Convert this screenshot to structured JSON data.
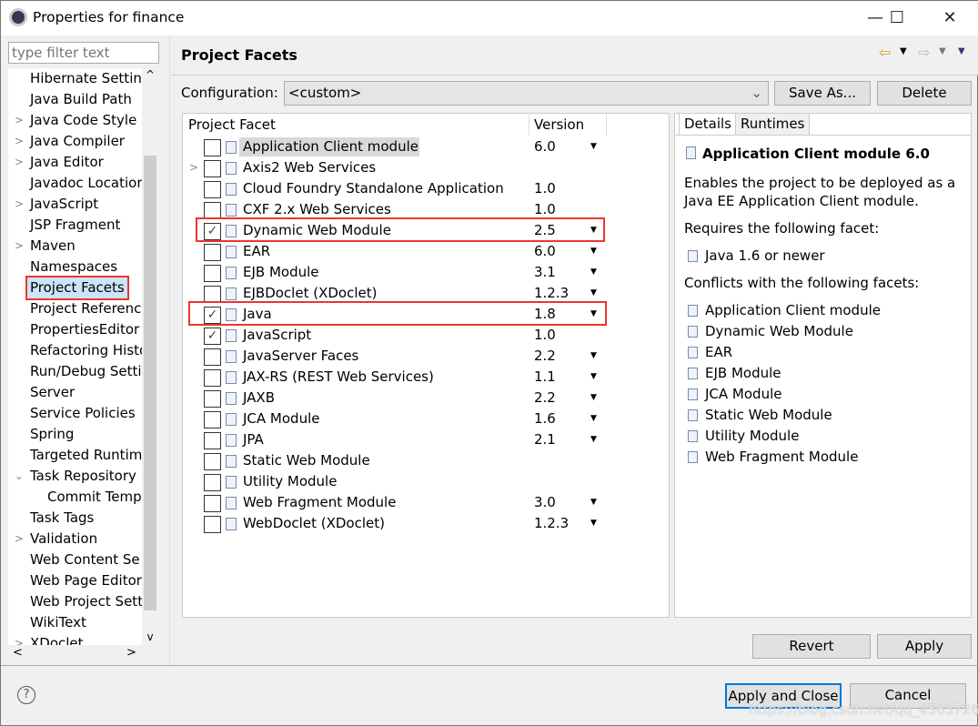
{
  "window": {
    "title": "Properties for finance",
    "minimize": "—",
    "maximize": "☐",
    "close": "✕"
  },
  "sidebar": {
    "filter_placeholder": "type filter text",
    "items": [
      {
        "label": "Hibernate Settin",
        "arrow": ""
      },
      {
        "label": "Java Build Path",
        "arrow": ""
      },
      {
        "label": "Java Code Style",
        "arrow": ">"
      },
      {
        "label": "Java Compiler",
        "arrow": ">"
      },
      {
        "label": "Java Editor",
        "arrow": ">"
      },
      {
        "label": "Javadoc Locatior",
        "arrow": ""
      },
      {
        "label": "JavaScript",
        "arrow": ">"
      },
      {
        "label": "JSP Fragment",
        "arrow": ""
      },
      {
        "label": "Maven",
        "arrow": ">"
      },
      {
        "label": "Namespaces",
        "arrow": ""
      },
      {
        "label": "Project Facets",
        "arrow": "",
        "selected": true
      },
      {
        "label": "Project Referenc",
        "arrow": ""
      },
      {
        "label": "PropertiesEditor",
        "arrow": ""
      },
      {
        "label": "Refactoring Histo",
        "arrow": ""
      },
      {
        "label": "Run/Debug Setti",
        "arrow": ""
      },
      {
        "label": "Server",
        "arrow": ""
      },
      {
        "label": "Service Policies",
        "arrow": ""
      },
      {
        "label": "Spring",
        "arrow": ""
      },
      {
        "label": "Targeted Runtim",
        "arrow": ""
      },
      {
        "label": "Task Repository",
        "arrow": "v"
      },
      {
        "label": "Commit Temp",
        "arrow": "",
        "indent": true
      },
      {
        "label": "Task Tags",
        "arrow": ""
      },
      {
        "label": "Validation",
        "arrow": ">"
      },
      {
        "label": "Web Content Se",
        "arrow": ""
      },
      {
        "label": "Web Page Editor",
        "arrow": ""
      },
      {
        "label": "Web Project Sett",
        "arrow": ""
      },
      {
        "label": "WikiText",
        "arrow": ""
      },
      {
        "label": "XDoclet",
        "arrow": ">"
      }
    ]
  },
  "page": {
    "title": "Project Facets",
    "config_label": "Configuration:",
    "config_value": "<custom>",
    "save_as": "Save As...",
    "delete": "Delete",
    "col_facet": "Project Facet",
    "col_version": "Version",
    "facets": [
      {
        "name": "Application Client module",
        "version": "6.0",
        "checked": false,
        "dd": true
      },
      {
        "name": "Axis2 Web Services",
        "version": "",
        "checked": false,
        "dd": false,
        "expand": true
      },
      {
        "name": "Cloud Foundry Standalone Application",
        "version": "1.0",
        "checked": false,
        "dd": false
      },
      {
        "name": "CXF 2.x Web Services",
        "version": "1.0",
        "checked": false,
        "dd": false
      },
      {
        "name": "Dynamic Web Module",
        "version": "2.5",
        "checked": true,
        "dd": true,
        "highlight": true
      },
      {
        "name": "EAR",
        "version": "6.0",
        "checked": false,
        "dd": true
      },
      {
        "name": "EJB Module",
        "version": "3.1",
        "checked": false,
        "dd": true
      },
      {
        "name": "EJBDoclet (XDoclet)",
        "version": "1.2.3",
        "checked": false,
        "dd": true
      },
      {
        "name": "Java",
        "version": "1.8",
        "checked": true,
        "dd": true,
        "highlight": true
      },
      {
        "name": "JavaScript",
        "version": "1.0",
        "checked": true,
        "dd": false
      },
      {
        "name": "JavaServer Faces",
        "version": "2.2",
        "checked": false,
        "dd": true
      },
      {
        "name": "JAX-RS (REST Web Services)",
        "version": "1.1",
        "checked": false,
        "dd": true
      },
      {
        "name": "JAXB",
        "version": "2.2",
        "checked": false,
        "dd": true
      },
      {
        "name": "JCA Module",
        "version": "1.6",
        "checked": false,
        "dd": true
      },
      {
        "name": "JPA",
        "version": "2.1",
        "checked": false,
        "dd": true
      },
      {
        "name": "Static Web Module",
        "version": "",
        "checked": false,
        "dd": false
      },
      {
        "name": "Utility Module",
        "version": "",
        "checked": false,
        "dd": false
      },
      {
        "name": "Web Fragment Module",
        "version": "3.0",
        "checked": false,
        "dd": true
      },
      {
        "name": "WebDoclet (XDoclet)",
        "version": "1.2.3",
        "checked": false,
        "dd": true
      }
    ],
    "details": {
      "tab_details": "Details",
      "tab_runtimes": "Runtimes",
      "heading": "Application Client module 6.0",
      "desc1": "Enables the project to be deployed as a",
      "desc2": "Java EE Application Client module.",
      "requires": "Requires the following facet:",
      "req_items": [
        "Java 1.6 or newer"
      ],
      "conflicts": "Conflicts with the following facets:",
      "conflict_items": [
        "Application Client module",
        "Dynamic Web Module",
        "EAR",
        "EJB Module",
        "JCA Module",
        "Static Web Module",
        "Utility Module",
        "Web Fragment Module"
      ]
    },
    "revert": "Revert",
    "apply": "Apply"
  },
  "footer": {
    "help": "?",
    "apply_close": "Apply and Close",
    "cancel": "Cancel"
  },
  "watermark": "https://blog.csdn.net/qq_45637260",
  "colors": {
    "highlight": "#ee3333",
    "focus": "#0078d7"
  }
}
